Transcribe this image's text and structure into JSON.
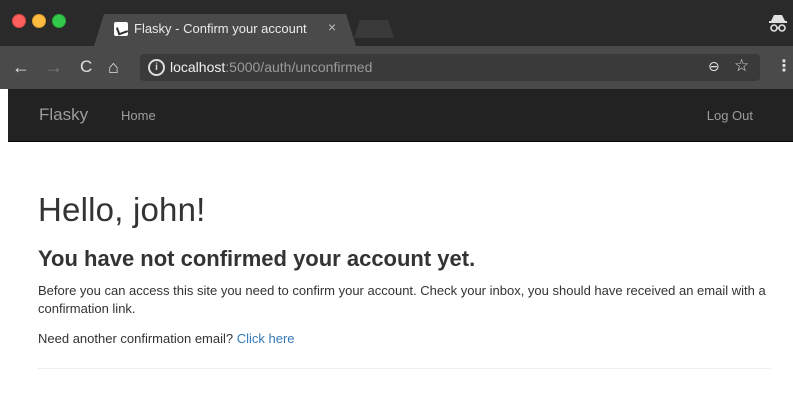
{
  "browser": {
    "tab_title": "Flasky - Confirm your account",
    "tab_close": "×",
    "url_host": "localhost",
    "url_path": ":5000/auth/unconfirmed",
    "icons": {
      "back": "←",
      "forward": "→",
      "reload": "C",
      "home": "⌂",
      "info": "i",
      "zoom": "⊖",
      "star": "☆",
      "menu": "⋮"
    }
  },
  "navbar": {
    "brand": "Flasky",
    "home": "Home",
    "logout": "Log Out",
    "bg_color": "#222222",
    "text_color": "#9d9d9d"
  },
  "page": {
    "greeting": "Hello, john!",
    "subheading": "You have not confirmed your account yet.",
    "message": "Before you can access this site you need to confirm your account. Check your inbox, you should have received an email with a confirmation link.",
    "prompt": "Need another confirmation email?",
    "link_text": "Click here",
    "link_color": "#337ab7"
  }
}
